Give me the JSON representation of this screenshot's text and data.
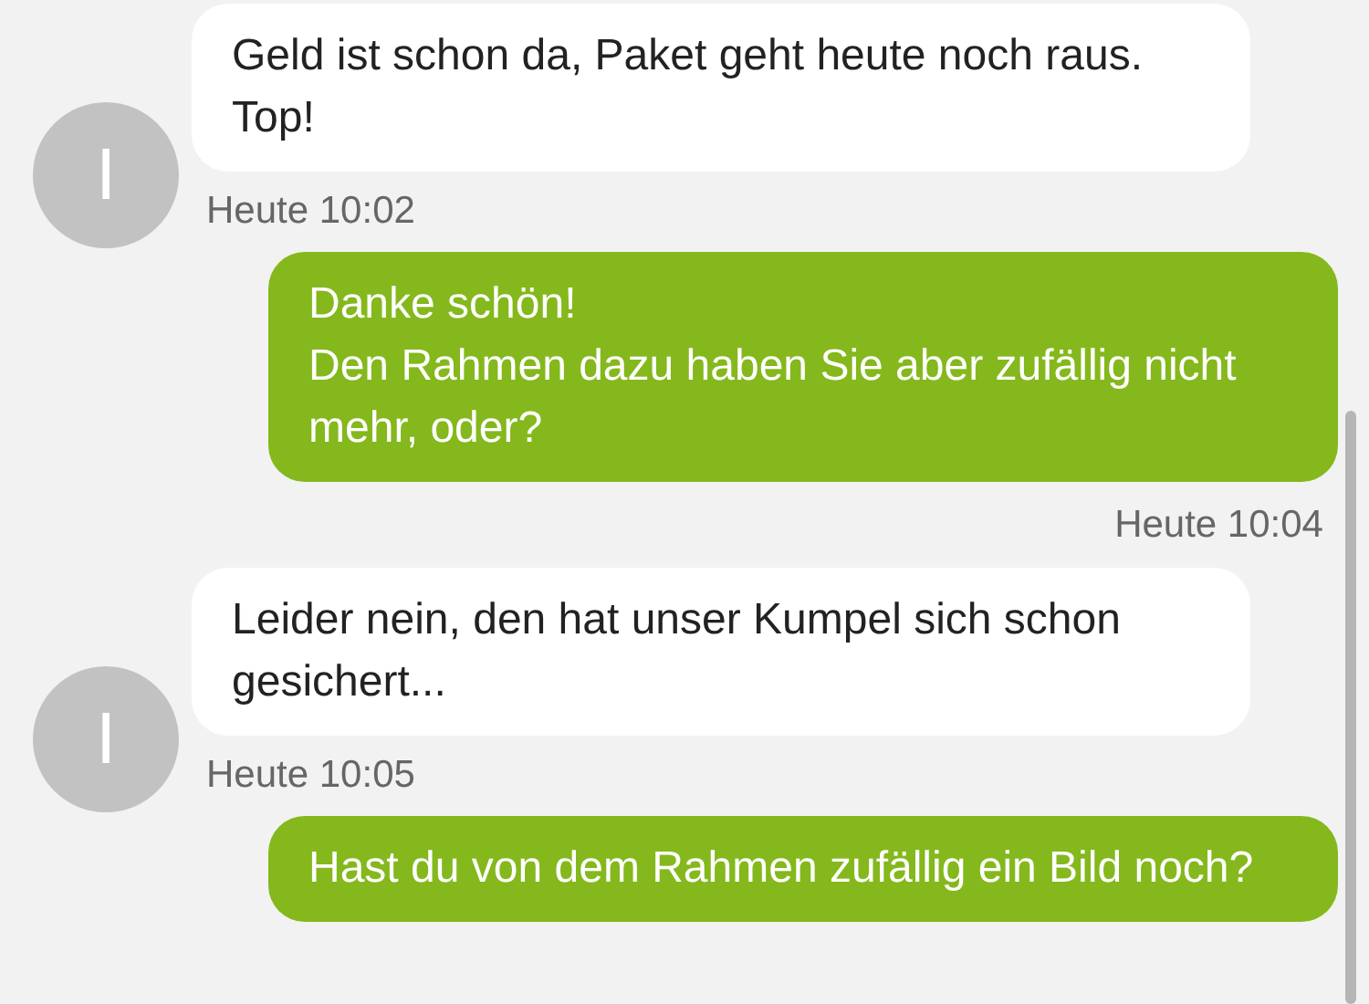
{
  "messages": [
    {
      "kind": "incoming",
      "avatar": "I",
      "text": "Geld ist schon da, Paket geht heute noch raus. Top!",
      "time": "Heute 10:02"
    },
    {
      "kind": "outgoing",
      "text": "Danke schön!\nDen Rahmen dazu haben Sie aber zufällig nicht mehr, oder?",
      "time": "Heute 10:04"
    },
    {
      "kind": "incoming",
      "avatar": "I",
      "text": "Leider nein, den hat unser Kumpel sich schon gesichert...",
      "time": "Heute 10:05"
    },
    {
      "kind": "outgoing",
      "text": "Hast du von dem Rahmen zufällig ein Bild noch?"
    }
  ]
}
